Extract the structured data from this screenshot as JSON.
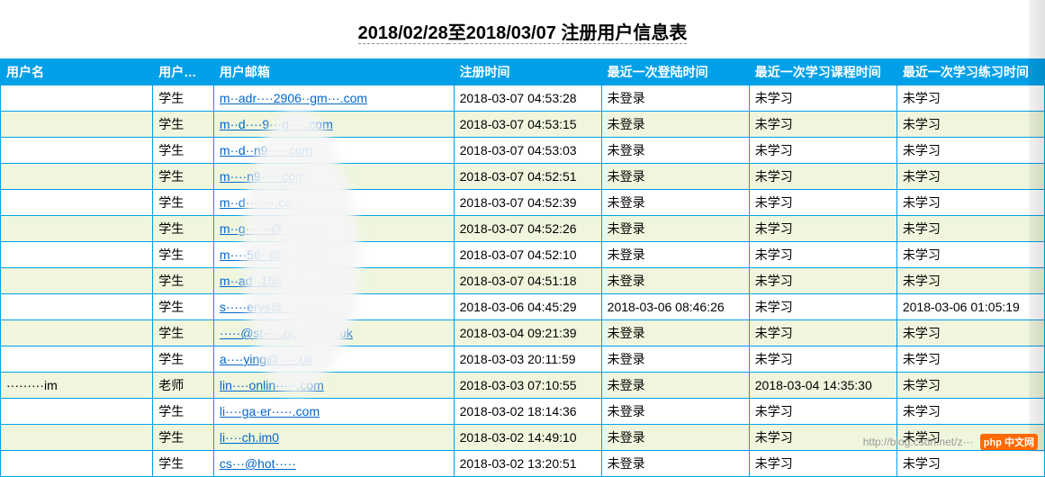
{
  "title_prefix": "2018/02/28",
  "title_mid": "至",
  "title_suffix": "2018/03/07 注册用户信息表",
  "columns": {
    "username": "用户名",
    "type": "用户类型",
    "email": "用户邮箱",
    "reg": "注册时间",
    "login": "最近一次登陆时间",
    "course": "最近一次学习课程时间",
    "practice": "最近一次学习练习时间"
  },
  "rows": [
    {
      "username": "",
      "type": "学生",
      "email": "m··adr····2906··gm···.com",
      "reg": "2018-03-07 04:53:28",
      "login": "未登录",
      "course": "未学习",
      "practice": "未学习"
    },
    {
      "username": "",
      "type": "学生",
      "email": "m··d····9···g····.com",
      "reg": "2018-03-07 04:53:15",
      "login": "未登录",
      "course": "未学习",
      "practice": "未学习"
    },
    {
      "username": "",
      "type": "学生",
      "email": "m··d··n9·····com",
      "reg": "2018-03-07 04:53:03",
      "login": "未登录",
      "course": "未学习",
      "practice": "未学习"
    },
    {
      "username": "",
      "type": "学生",
      "email": "m····n9·····com",
      "reg": "2018-03-07 04:52:51",
      "login": "未登录",
      "course": "未学习",
      "practice": "未学习"
    },
    {
      "username": "",
      "type": "学生",
      "email": "m··d·······.com",
      "reg": "2018-03-07 04:52:39",
      "login": "未登录",
      "course": "未学习",
      "practice": "未学习"
    },
    {
      "username": "",
      "type": "学生",
      "email": "m··g······@····.com",
      "reg": "2018-03-07 04:52:26",
      "login": "未登录",
      "course": "未学习",
      "practice": "未学习"
    },
    {
      "username": "",
      "type": "学生",
      "email": "m····56··@····.com",
      "reg": "2018-03-07 04:52:10",
      "login": "未登录",
      "course": "未学习",
      "practice": "未学习"
    },
    {
      "username": "",
      "type": "学生",
      "email": "m··ad··156····a···.com",
      "reg": "2018-03-07 04:51:18",
      "login": "未登录",
      "course": "未学习",
      "practice": "未学习"
    },
    {
      "username": "",
      "type": "学生",
      "email": "s·····erys@····.com",
      "reg": "2018-03-06 04:45:29",
      "login": "2018-03-06 08:46:26",
      "course": "未学习",
      "practice": "2018-03-06 01:05:19"
    },
    {
      "username": "",
      "type": "学生",
      "email": "·····@st-···.gor···.org.uk",
      "reg": "2018-03-04 09:21:39",
      "login": "未登录",
      "course": "未学习",
      "practice": "未学习"
    },
    {
      "username": "",
      "type": "学生",
      "email": "a····ying@····.uk",
      "reg": "2018-03-03 20:11:59",
      "login": "未登录",
      "course": "未学习",
      "practice": "未学习"
    },
    {
      "username": "·········im",
      "type": "老师",
      "email": "lin····onlin·····.com",
      "reg": "2018-03-03 07:10:55",
      "login": "未登录",
      "course": "2018-03-04 14:35:30",
      "practice": "未学习"
    },
    {
      "username": "",
      "type": "学生",
      "email": "li····ga·er·····.com",
      "reg": "2018-03-02 18:14:36",
      "login": "未登录",
      "course": "未学习",
      "practice": "未学习"
    },
    {
      "username": "",
      "type": "学生",
      "email": "li····ch.im0",
      "reg": "2018-03-02 14:49:10",
      "login": "未登录",
      "course": "未学习",
      "practice": "未学习"
    },
    {
      "username": "",
      "type": "学生",
      "email": "cs···@hot·····",
      "reg": "2018-03-02 13:20:51",
      "login": "未登录",
      "course": "未学习",
      "practice": "未学习"
    }
  ],
  "watermark": {
    "url": "http://blog.csdn.net/z···",
    "badge": "php 中文网"
  }
}
